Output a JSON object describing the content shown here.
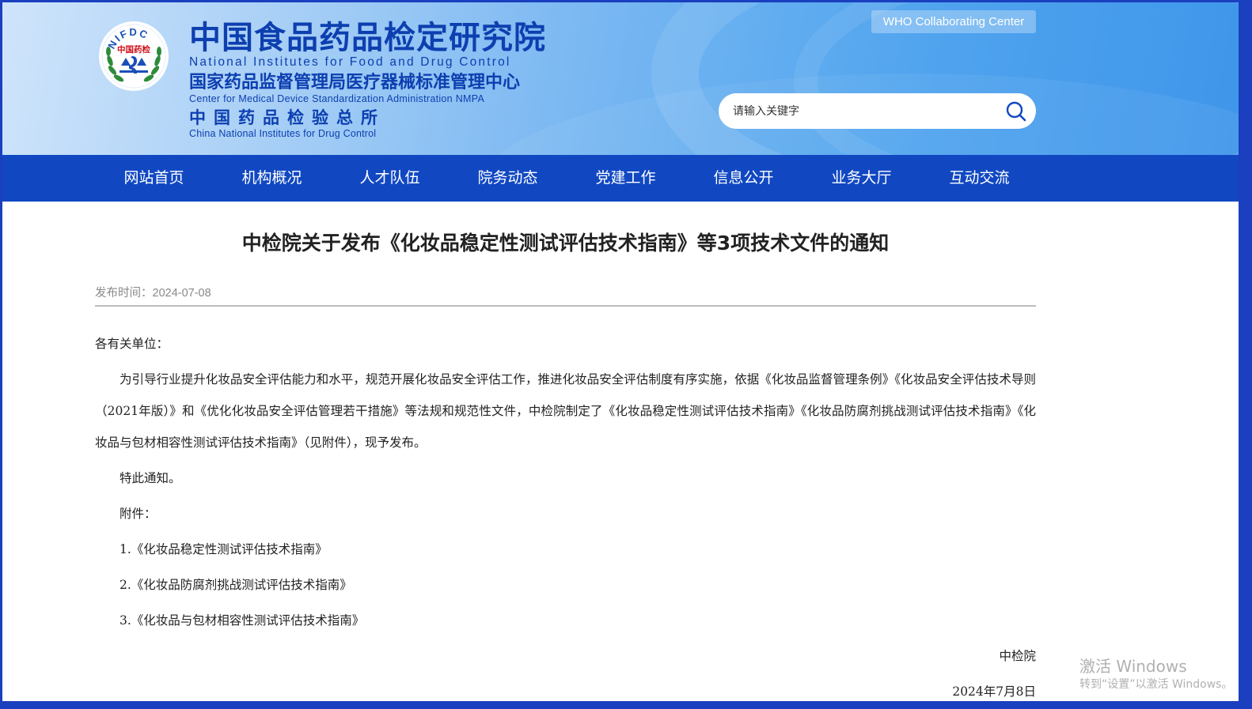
{
  "header": {
    "logo": {
      "ring_text": "NIFDC",
      "center_text": "中国药检"
    },
    "org_name_cn": "中国食品药品检定研究院",
    "org_name_en": "National Institutes for Food and Drug Control",
    "sub_org_cn": "国家药品监督管理局医疗器械标准管理中心",
    "sub_org_en": "Center for Medical Device Standardization Administration NMPA",
    "sub_org2_cn": "中国药品检验总所",
    "sub_org2_en": "China National Institutes for Drug Control",
    "who_badge": "WHO Collaborating Center",
    "search": {
      "placeholder": "请输入关键字",
      "icon": "search-icon"
    }
  },
  "nav": {
    "items": [
      {
        "label": "网站首页"
      },
      {
        "label": "机构概况"
      },
      {
        "label": "人才队伍"
      },
      {
        "label": "院务动态"
      },
      {
        "label": "党建工作"
      },
      {
        "label": "信息公开"
      },
      {
        "label": "业务大厅"
      },
      {
        "label": "互动交流"
      }
    ]
  },
  "article": {
    "title": "中检院关于发布《化妆品稳定性测试评估技术指南》等3项技术文件的通知",
    "publish_label": "发布时间：",
    "publish_date": "2024-07-08",
    "salutation": "各有关单位：",
    "paragraph": "为引导行业提升化妆品安全评估能力和水平，规范开展化妆品安全评估工作，推进化妆品安全评估制度有序实施，依据《化妆品监督管理条例》《化妆品安全评估技术导则（2021年版）》和《优化化妆品安全评估管理若干措施》等法规和规范性文件，中检院制定了《化妆品稳定性测试评估技术指南》《化妆品防腐剂挑战测试评估技术指南》《化妆品与包材相容性测试评估技术指南》（见附件），现予发布。",
    "notice": "特此通知。",
    "attachments_label": "附件：",
    "attachments": [
      "1.《化妆品稳定性测试评估技术指南》",
      "2.《化妆品防腐剂挑战测试评估技术指南》",
      "3.《化妆品与包材相容性测试评估技术指南》"
    ],
    "signature": "中检院",
    "sign_date": "2024年7月8日"
  },
  "watermark": {
    "line1": "激活 Windows",
    "line2": "转到“设置”以激活 Windows。"
  },
  "colors": {
    "nav_bg": "#1148c2",
    "brand_text": "#0d3fb0",
    "frame_border": "#1a3fbf"
  }
}
